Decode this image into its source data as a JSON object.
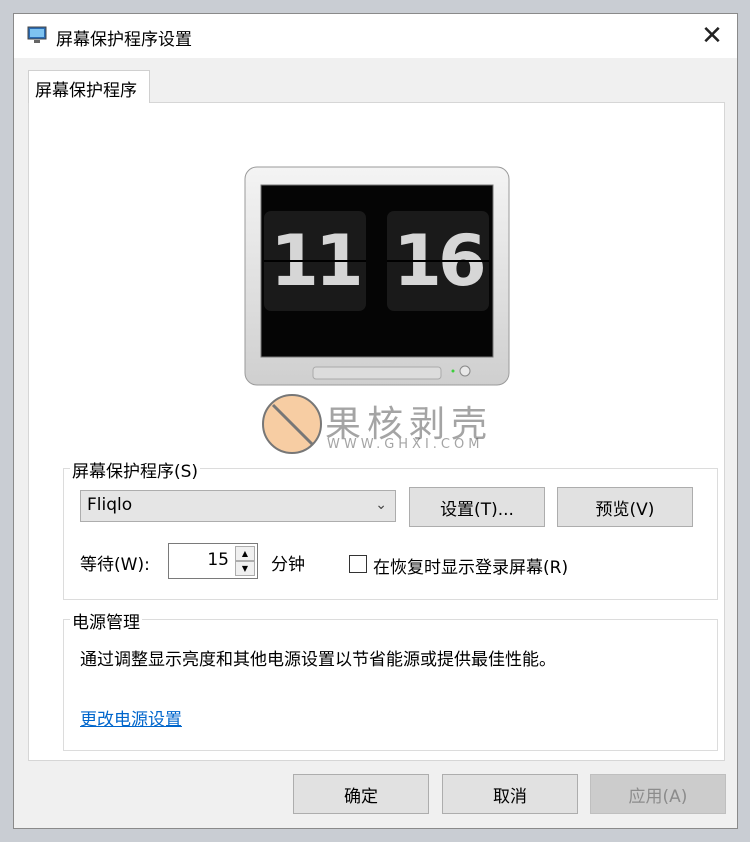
{
  "window": {
    "title": "屏幕保护程序设置"
  },
  "tab": {
    "label": "屏幕保护程序"
  },
  "preview": {
    "clock_hours": "11",
    "clock_minutes": "16"
  },
  "watermark": {
    "text": "果核剥壳",
    "url": "WWW.GHXI.COM"
  },
  "screensaver": {
    "group_label": "屏幕保护程序(S)",
    "selected": "Fliqlo",
    "settings_button": "设置(T)...",
    "preview_button": "预览(V)",
    "wait_label": "等待(W):",
    "wait_value": "15",
    "wait_unit": "分钟",
    "resume_label": "在恢复时显示登录屏幕(R)"
  },
  "power": {
    "group_label": "电源管理",
    "description": "通过调整显示亮度和其他电源设置以节省能源或提供最佳性能。",
    "link": "更改电源设置"
  },
  "footer": {
    "ok": "确定",
    "cancel": "取消",
    "apply": "应用(A)"
  },
  "icons": {
    "app": "display-settings-icon",
    "close": "close-icon",
    "dropdown": "chevron-down-icon"
  }
}
